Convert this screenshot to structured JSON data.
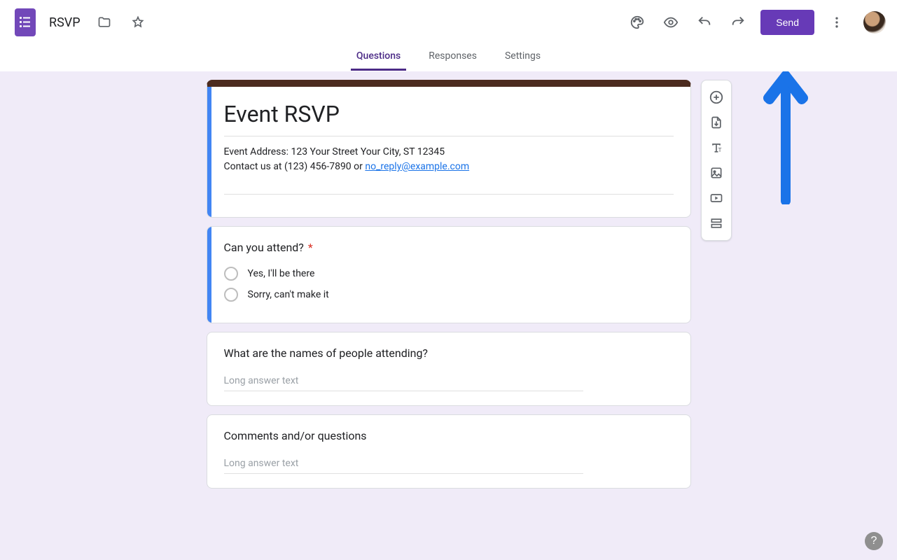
{
  "header": {
    "doc_title": "RSVP",
    "send_label": "Send"
  },
  "tabs": {
    "questions": "Questions",
    "responses": "Responses",
    "settings": "Settings"
  },
  "form": {
    "title": "Event RSVP",
    "desc_line1": "Event Address: 123 Your Street Your City, ST 12345",
    "desc_contact_prefix": "Contact us at (123) 456-7890 or ",
    "desc_email": "no_reply@example.com"
  },
  "q1": {
    "title": "Can you attend?",
    "required_marker": "*",
    "opt1": "Yes,  I'll be there",
    "opt2": "Sorry, can't make it"
  },
  "q2": {
    "title": "What are the names of people attending?",
    "placeholder": "Long answer text"
  },
  "q3": {
    "title": "Comments and/or questions",
    "placeholder": "Long answer text"
  },
  "help": {
    "label": "?"
  }
}
